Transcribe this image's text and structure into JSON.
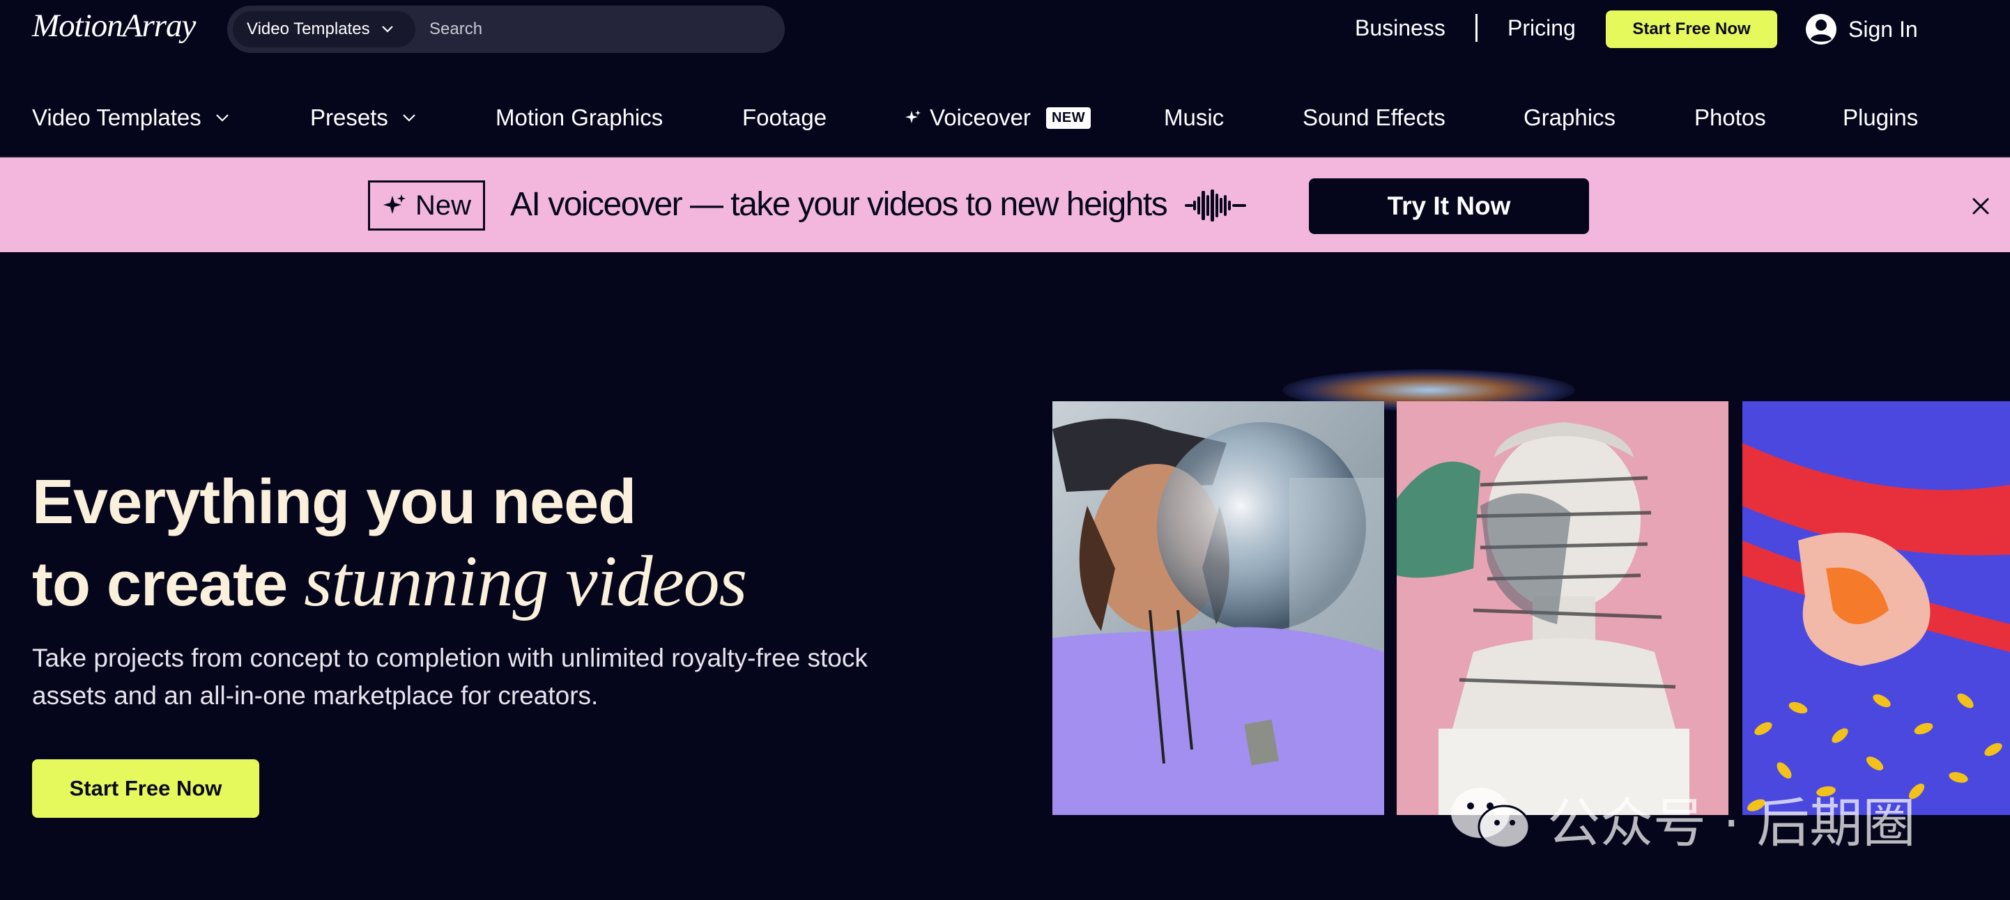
{
  "header": {
    "logo_text": "MotionArray",
    "search_category": "Video Templates",
    "search_placeholder": "Search",
    "business": "Business",
    "pricing": "Pricing",
    "start_free": "Start Free Now",
    "sign_in": "Sign In"
  },
  "nav": {
    "items": [
      {
        "label": "Video Templates"
      },
      {
        "label": "Presets"
      },
      {
        "label": "Motion Graphics"
      },
      {
        "label": "Footage"
      },
      {
        "label": "Voiceover",
        "badge": "NEW"
      },
      {
        "label": "Music"
      },
      {
        "label": "Sound Effects"
      },
      {
        "label": "Graphics"
      },
      {
        "label": "Photos"
      },
      {
        "label": "Plugins"
      }
    ]
  },
  "banner": {
    "tag": "New",
    "text": "AI voiceover — take your videos to new heights",
    "cta": "Try It Now"
  },
  "hero": {
    "title_line1": "Everything you need",
    "title_line2_plain": "to create ",
    "title_line2_italic": "stunning videos",
    "subtitle": "Take projects from concept to completion with unlimited royalty-free stock assets and an all-in-one marketplace for creators.",
    "cta": "Start Free Now"
  },
  "watermark": "公众号 · 后期圈",
  "colors": {
    "background": "#05061c",
    "accent": "#e6f95c",
    "banner": "#f3b7dd",
    "hero_text": "#faf0dc"
  }
}
